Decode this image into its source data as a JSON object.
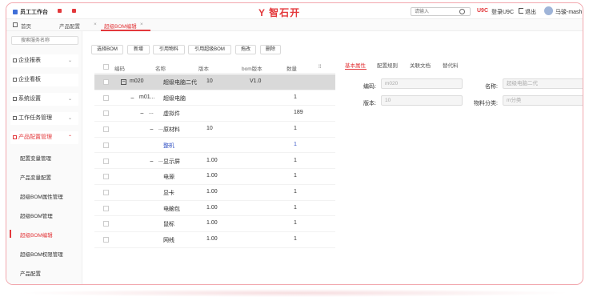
{
  "header": {
    "app_title": "员工工作台",
    "logo_text": "智石开",
    "search_placeholder": "请输入",
    "u9c_badge": "U9C",
    "u9c_login": "登录U9C",
    "exit_label": "退出",
    "user_name": "马骏-mash"
  },
  "tabs": {
    "home": "首页",
    "items": [
      {
        "label": "产品配置",
        "active": false
      },
      {
        "label": "超级BOM编辑",
        "active": true
      }
    ]
  },
  "sidebar": {
    "search_placeholder": "搜索服务名称",
    "menus": [
      {
        "label": "企业报表",
        "chevron": "⌄"
      },
      {
        "label": "企业看板",
        "chevron": ""
      },
      {
        "label": "系统设置",
        "chevron": "⌄"
      },
      {
        "label": "工作任务管理",
        "chevron": "⌄"
      },
      {
        "label": "产品配置管理",
        "chevron": "⌃"
      }
    ],
    "sub_items": [
      {
        "label": "配置变量管理",
        "active": false
      },
      {
        "label": "产品变量配置",
        "active": false
      },
      {
        "label": "超级BOM属性管理",
        "active": false
      },
      {
        "label": "超级BOM管理",
        "active": false
      },
      {
        "label": "超级BOM编辑",
        "active": true
      },
      {
        "label": "超级BOM权限管理",
        "active": false
      },
      {
        "label": "产品配置",
        "active": false
      }
    ]
  },
  "toolbar": {
    "buttons": [
      "选择BOM",
      "新增",
      "引用物料",
      "引用超级BOM",
      "拖改",
      "删除"
    ]
  },
  "grid": {
    "headers": {
      "code": "编码",
      "name": "名称",
      "version": "版本",
      "bom_version": "bom版本",
      "qty": "数量",
      "settings": "⁞⁞"
    },
    "rows": [
      {
        "toggle": "−",
        "code": "m020",
        "name": "超级电脑二代",
        "version": "10",
        "bom_version": "V1.0",
        "qty": "",
        "selected": true,
        "blue": false
      },
      {
        "toggle": "−",
        "code": "m01...",
        "name": "超级电脑",
        "version": "",
        "bom_version": "",
        "qty": "1",
        "selected": false,
        "blue": false
      },
      {
        "toggle": "−",
        "code": "...",
        "name": "虚拟件",
        "version": "",
        "bom_version": "",
        "qty": "189",
        "selected": false,
        "blue": false
      },
      {
        "toggle": "−",
        "code": "...",
        "name": "原材料",
        "version": "10",
        "bom_version": "",
        "qty": "1",
        "selected": false,
        "blue": false
      },
      {
        "toggle": "",
        "code": "...",
        "name": "整机",
        "version": "",
        "bom_version": "",
        "qty": "1",
        "selected": false,
        "blue": true
      },
      {
        "toggle": "−",
        "code": "...",
        "name": "显示屏",
        "version": "1.00",
        "bom_version": "",
        "qty": "1",
        "selected": false,
        "blue": false
      },
      {
        "toggle": "",
        "code": "...",
        "name": "电源",
        "version": "1.00",
        "bom_version": "",
        "qty": "1",
        "selected": false,
        "blue": false
      },
      {
        "toggle": "",
        "code": "...",
        "name": "显卡",
        "version": "1.00",
        "bom_version": "",
        "qty": "1",
        "selected": false,
        "blue": false
      },
      {
        "toggle": "",
        "code": "...",
        "name": "电脑包",
        "version": "1.00",
        "bom_version": "",
        "qty": "1",
        "selected": false,
        "blue": false
      },
      {
        "toggle": "",
        "code": "...",
        "name": "鼠标",
        "version": "1.00",
        "bom_version": "",
        "qty": "1",
        "selected": false,
        "blue": false
      },
      {
        "toggle": "",
        "code": "...",
        "name": "网线",
        "version": "1.00",
        "bom_version": "",
        "qty": "1",
        "selected": false,
        "blue": false
      }
    ]
  },
  "detail": {
    "tabs": [
      {
        "label": "基本属性",
        "active": true
      },
      {
        "label": "配置规则",
        "active": false
      },
      {
        "label": "关联文档",
        "active": false
      },
      {
        "label": "替代料",
        "active": false
      }
    ],
    "fields": {
      "code_label": "编码:",
      "code_value": "m020",
      "name_label": "名称:",
      "name_value": "超级电脑二代",
      "version_label": "版本:",
      "version_value": "10",
      "category_label": "物料分类:",
      "category_value": "m分类"
    }
  },
  "colors": {
    "accent": "#e3393c",
    "link": "#3857c7",
    "frame": "#f2a7ad"
  }
}
